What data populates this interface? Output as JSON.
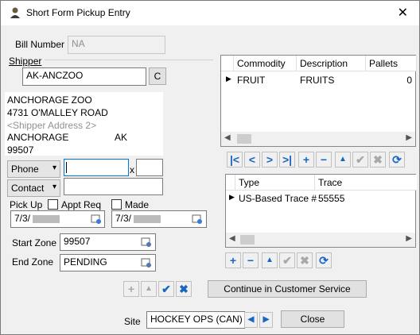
{
  "window": {
    "title": "Short Form Pickup Entry",
    "close": "✕"
  },
  "bill_number": {
    "label": "Bill Number",
    "value": "NA"
  },
  "shipper": {
    "label": "Shipper",
    "code": "AK-ANCZOO",
    "c_button": "C",
    "name": "ANCHORAGE ZOO",
    "address1": "4731 O'MALLEY ROAD",
    "address2": "<Shipper Address 2>",
    "city": "ANCHORAGE",
    "state": "AK",
    "zip": "99507"
  },
  "phone": {
    "type": "Phone",
    "value": "",
    "x_label": "x",
    "ext": ""
  },
  "contact": {
    "type": "Contact",
    "value": ""
  },
  "pickup": {
    "label": "Pick Up",
    "appt_req": "Appt Req",
    "made": "Made",
    "date1": "7/3/",
    "date2": "7/3/"
  },
  "start_zone": {
    "label": "Start Zone",
    "value": "99507"
  },
  "end_zone": {
    "label": "End Zone",
    "value": "PENDING"
  },
  "commodity_grid": {
    "columns": [
      "Commodity",
      "Description",
      "Pallets"
    ],
    "rows": [
      {
        "commodity": "FRUIT",
        "description": "FRUITS",
        "pallets": "0"
      }
    ]
  },
  "trace_grid": {
    "columns": [
      "Type",
      "Trace"
    ],
    "rows": [
      {
        "type": "US-Based Trace #",
        "trace": "55555"
      }
    ]
  },
  "continue_button": "Continue in Customer Service",
  "site": {
    "label": "Site",
    "value": "HOCKEY OPS (CAN)"
  },
  "close_button": "Close",
  "colors": {
    "accent": "#1766c0",
    "focus": "#0078d7"
  }
}
